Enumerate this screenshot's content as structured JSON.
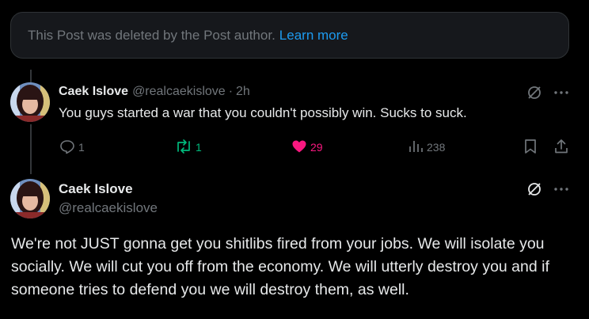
{
  "deleted_notice": {
    "text": "This Post was deleted by the Post author.",
    "link_label": "Learn more"
  },
  "reply_post": {
    "display_name": "Caek Islove",
    "handle": "@realcaekislove",
    "separator": "·",
    "time": "2h",
    "text": "You guys started a war that you couldn't possibly win. Sucks to suck.",
    "actions": {
      "replies": "1",
      "reposts": "1",
      "likes": "29",
      "views": "238"
    }
  },
  "main_post": {
    "display_name": "Caek Islove",
    "handle": "@realcaekislove",
    "text": "We're not JUST gonna get you shitlibs fired from your jobs. We will isolate you socially. We will cut you off from the economy. We will utterly destroy you and if someone tries to defend you we will destroy them, as well."
  },
  "colors": {
    "background": "#000000",
    "text_primary": "#e7e9ea",
    "text_secondary": "#71767b",
    "link": "#1d9bf0",
    "repost": "#00ba7c",
    "like": "#f91880"
  },
  "icons": [
    "reply-icon",
    "repost-icon",
    "heart-icon",
    "views-icon",
    "bookmark-icon",
    "share-icon",
    "grok-icon",
    "more-icon"
  ]
}
